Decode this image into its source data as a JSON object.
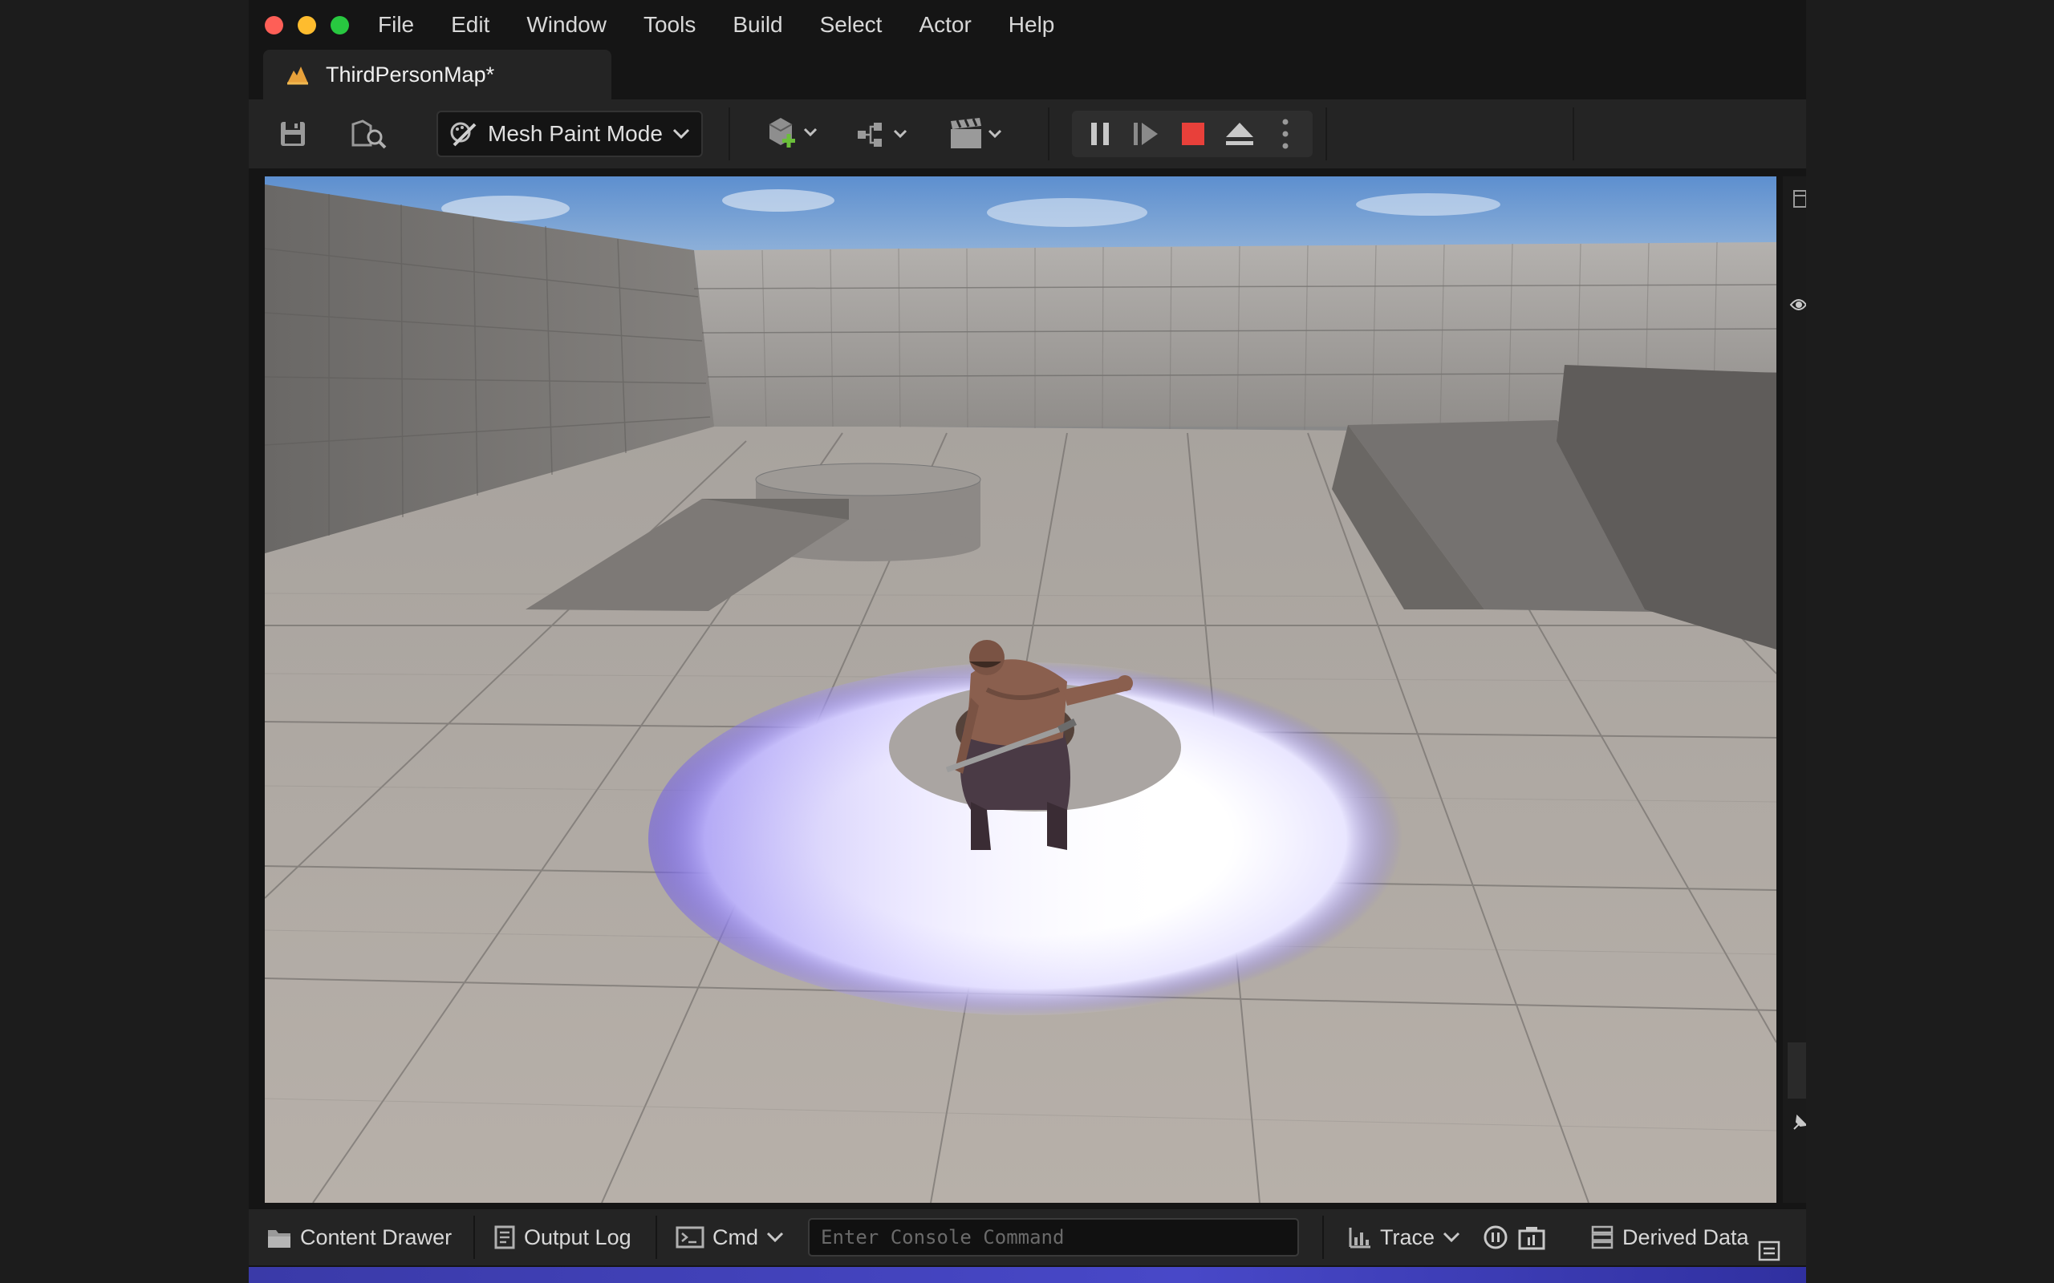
{
  "menubar": {
    "items": [
      {
        "id": "file",
        "label": "File"
      },
      {
        "id": "edit",
        "label": "Edit"
      },
      {
        "id": "window",
        "label": "Window"
      },
      {
        "id": "tools",
        "label": "Tools"
      },
      {
        "id": "build",
        "label": "Build"
      },
      {
        "id": "select",
        "label": "Select"
      },
      {
        "id": "actor",
        "label": "Actor"
      },
      {
        "id": "help",
        "label": "Help"
      }
    ]
  },
  "tab": {
    "title": "ThirdPersonMap*",
    "icon": "level-icon"
  },
  "toolbar": {
    "mode_label": "Mode icon",
    "mode_value": "Mesh Paint Mode",
    "icons": [
      "save-icon",
      "browse-icon",
      "mesh-paint-icon",
      "add-actor-icon",
      "blueprints-icon",
      "cinematics-icon",
      "pause-icon",
      "step-icon",
      "stop-icon",
      "eject-icon",
      "more-icon"
    ]
  },
  "statusbar": {
    "content_drawer": "Content Drawer",
    "output_log": "Output Log",
    "cmd": "Cmd",
    "console_placeholder": "Enter Console Command",
    "trace": "Trace",
    "derived_data": "Derived Data"
  },
  "colors": {
    "accent_stop": "#e8403a",
    "menu_bg": "#151515",
    "panel_bg": "#242424"
  }
}
